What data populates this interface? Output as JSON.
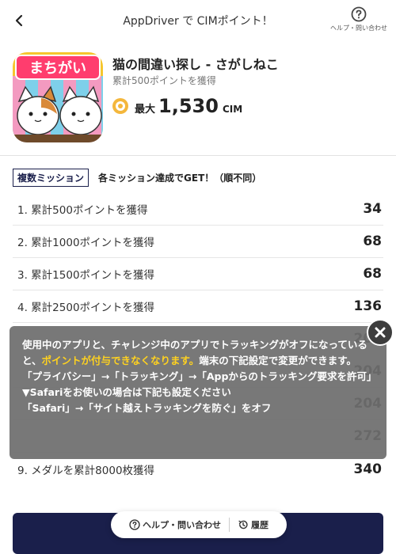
{
  "header": {
    "title": "AppDriver で CIMポイント！",
    "help_label": "ヘルプ・問い合わせ"
  },
  "app": {
    "name": "猫の間違い探し - さがしねこ",
    "subtitle": "累計500ポイントを獲得",
    "icon_text": "まちがい",
    "reward_prefix": "最大",
    "reward_amount": "1,530",
    "reward_unit": "CIM"
  },
  "missions": {
    "badge": "複数ミッション",
    "note": "各ミッション達成でGET！（順不同）",
    "items": [
      {
        "label": "1. 累計500ポイントを獲得",
        "points": "34"
      },
      {
        "label": "2. 累計1000ポイントを獲得",
        "points": "68"
      },
      {
        "label": "3. 累計1500ポイントを獲得",
        "points": "68"
      },
      {
        "label": "4. 累計2500ポイントを獲得",
        "points": "136"
      },
      {
        "label": "",
        "points": "204"
      },
      {
        "label": "",
        "points": "204"
      },
      {
        "label": "",
        "points": "204"
      },
      {
        "label": "",
        "points": "272"
      },
      {
        "label": "9. メダルを累計8000枚獲得",
        "points": "340"
      }
    ]
  },
  "notice": {
    "line1_a": "使用中のアプリと、チャレンジ中のアプリでトラッキングがオフになっていると、",
    "line1_highlight": "ポイントが付与できなくなります。",
    "line1_b": "端末の下記設定で変更ができます。",
    "line2": "「プライバシー」→「トラッキング」→「Appからのトラッキング要求を許可」",
    "line3": "▼Safariをお使いの場合は下記も設定ください",
    "line4": "「Safari」→「サイト越えトラッキングを防ぐ」をオフ"
  },
  "footer": {
    "help": "ヘルプ・問い合わせ",
    "history": "履歴"
  },
  "colors": {
    "navy": "#1a1f4b",
    "highlight": "#ffd21f",
    "coin": "#f4b73c"
  }
}
